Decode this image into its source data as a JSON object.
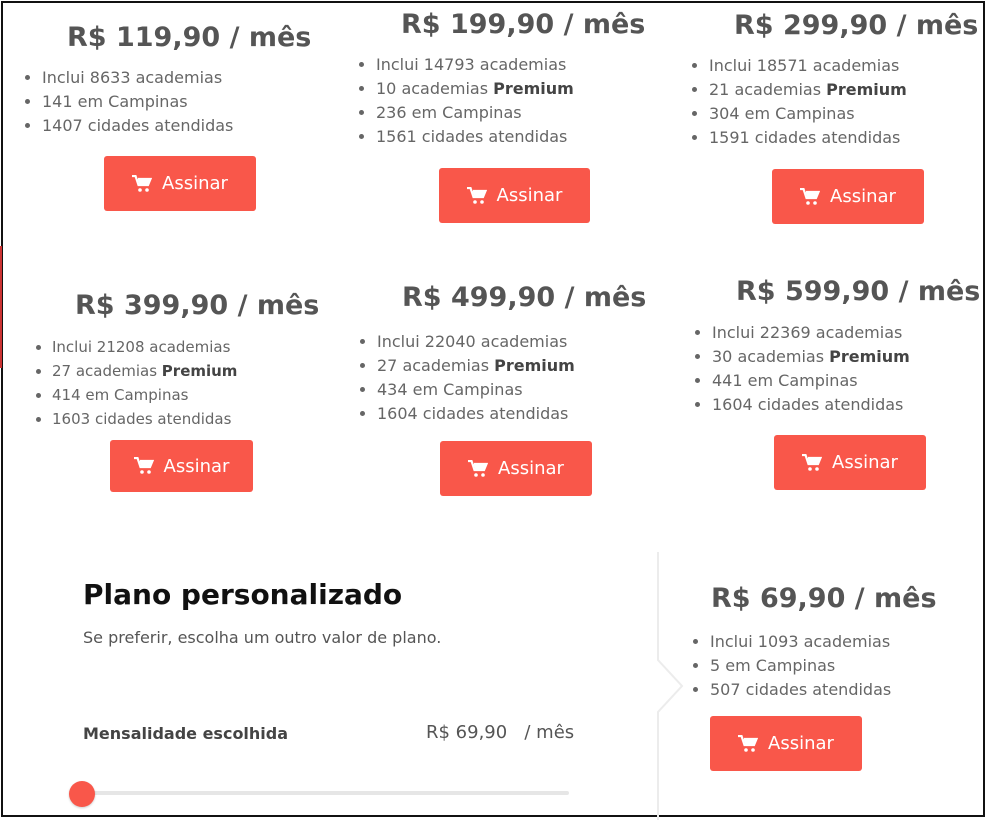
{
  "plans": [
    {
      "price": "R$ 119,90 / mês",
      "features": [
        {
          "text": "Inclui 8633 academias"
        },
        {
          "text": "141 em Campinas"
        },
        {
          "text": "1407 cidades atendidas"
        }
      ],
      "button": "Assinar"
    },
    {
      "price": "R$ 199,90 / mês",
      "features": [
        {
          "text": "Inclui 14793 academias"
        },
        {
          "text": "10 academias ",
          "bold": "Premium"
        },
        {
          "text": "236 em Campinas"
        },
        {
          "text": "1561 cidades atendidas"
        }
      ],
      "button": "Assinar"
    },
    {
      "price": "R$ 299,90 / mês",
      "features": [
        {
          "text": "Inclui 18571 academias"
        },
        {
          "text": "21 academias ",
          "bold": "Premium"
        },
        {
          "text": "304 em Campinas"
        },
        {
          "text": "1591 cidades atendidas"
        }
      ],
      "button": "Assinar"
    },
    {
      "price": "R$ 399,90 / mês",
      "features": [
        {
          "text": "Inclui 21208 academias"
        },
        {
          "text": "27 academias ",
          "bold": "Premium"
        },
        {
          "text": "414 em Campinas"
        },
        {
          "text": "1603 cidades atendidas"
        }
      ],
      "button": "Assinar"
    },
    {
      "price": "R$ 499,90 / mês",
      "features": [
        {
          "text": "Inclui 22040 academias"
        },
        {
          "text": "27 academias ",
          "bold": "Premium"
        },
        {
          "text": "434 em Campinas"
        },
        {
          "text": "1604 cidades atendidas"
        }
      ],
      "button": "Assinar"
    },
    {
      "price": "R$ 599,90 / mês",
      "features": [
        {
          "text": "Inclui 22369 academias"
        },
        {
          "text": "30 academias ",
          "bold": "Premium"
        },
        {
          "text": "441 em Campinas"
        },
        {
          "text": "1604 cidades atendidas"
        }
      ],
      "button": "Assinar"
    },
    {
      "price": "R$ 69,90 / mês",
      "features": [
        {
          "text": "Inclui 1093 academias"
        },
        {
          "text": "5 em Campinas"
        },
        {
          "text": "507 cidades atendidas"
        }
      ],
      "button": "Assinar"
    }
  ],
  "custom_plan": {
    "title": "Plano personalizado",
    "subtitle": "Se preferir, escolha um outro valor de plano.",
    "monthly_label": "Mensalidade escolhida",
    "monthly_value": "R$ 69,90   / mês",
    "slider_level": 0
  },
  "icons": {
    "button_icon": "shopping-cart-icon"
  },
  "colors": {
    "accent": "#f9574a",
    "text": "#555555",
    "heading": "#111111"
  }
}
